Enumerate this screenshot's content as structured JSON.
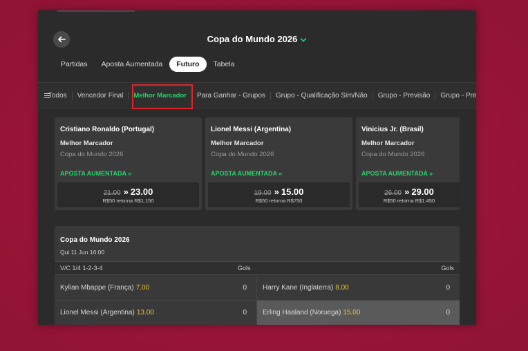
{
  "header": {
    "title": "Copa do Mundo 2026"
  },
  "tabs": [
    {
      "label": "Partidas",
      "active": false
    },
    {
      "label": "Aposta Aumentada",
      "active": false
    },
    {
      "label": "Futuro",
      "active": true
    },
    {
      "label": "Tabela",
      "active": false
    }
  ],
  "subnav": {
    "items": [
      {
        "label": "Todos"
      },
      {
        "label": "Vencedor Final"
      },
      {
        "label": "Melhor Marcador",
        "active": true
      },
      {
        "label": "Para Ganhar - Grupos"
      },
      {
        "label": "Grupo - Qualificação Sim/Não"
      },
      {
        "label": "Grupo - Previsão"
      },
      {
        "label": "Grupo - Previsão"
      }
    ]
  },
  "boost_cards": [
    {
      "name": "Cristiano Ronaldo (Portugal)",
      "market": "Melhor Marcador",
      "competition": "Copa do Mundo 2026",
      "boost_label": "APOSTA AUMENTADA »",
      "old_odds": "21.00",
      "arrows": "»",
      "new_odds": "23.00",
      "returns": "R$50 retorna R$1.150"
    },
    {
      "name": "Lionel Messi (Argentina)",
      "market": "Melhor Marcador",
      "competition": "Copa do Mundo 2026",
      "boost_label": "APOSTA AUMENTADA »",
      "old_odds": "19.00",
      "arrows": "»",
      "new_odds": "15.00",
      "returns": "R$50 retorna R$750"
    },
    {
      "name": "Vinicius Jr. (Brasil)",
      "market": "Melhor Marcador",
      "competition": "Copa do Mundo 2026",
      "boost_label": "APOSTA AUMENTADA »",
      "old_odds": "26.00",
      "arrows": "»",
      "new_odds": "29.00",
      "returns": "R$50 retorna R$1.450"
    }
  ],
  "market": {
    "title": "Copa do Mundo 2026",
    "date": "Qui 11 Jun 16:00",
    "header_left": "V/C 1/4 1-2-3-4",
    "header_gols": "Gols",
    "rows": [
      {
        "left": {
          "player": "Kylian Mbappe (França)",
          "price": "7.00",
          "gols": "0"
        },
        "right": {
          "player": "Harry Kane (Inglaterra)",
          "price": "8.00",
          "gols": "0"
        }
      },
      {
        "left": {
          "player": "Lionel Messi (Argentina)",
          "price": "13.00",
          "gols": "0"
        },
        "right": {
          "player": "Erling Haaland (Noruega)",
          "price": "15.00",
          "gols": "0"
        }
      }
    ]
  },
  "colors": {
    "accent_green": "#26d36b",
    "price_yellow": "#e7c534",
    "highlight_red": "#e0262b",
    "background_red": "#a0163a"
  }
}
